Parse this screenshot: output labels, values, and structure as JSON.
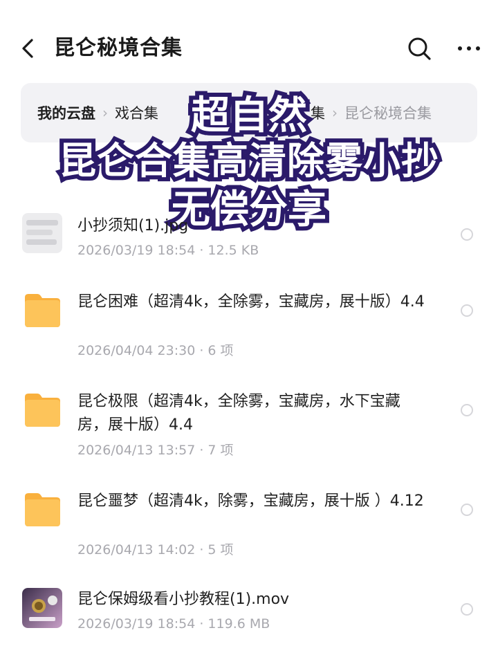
{
  "header": {
    "title": "昆仑秘境合集"
  },
  "breadcrumb": {
    "items": [
      "我的云盘",
      "游戏合集",
      "",
      "集",
      "昆仑秘境合集"
    ],
    "visible": [
      "我的云盘",
      "戏合集",
      "集",
      "昆仑秘境合集"
    ]
  },
  "banner": {
    "line1": "超自然",
    "line2": "昆仑合集高清除雾小抄",
    "line3": "无偿分享"
  },
  "files": [
    {
      "name": "小抄须知(1).jpg",
      "meta": "2026/03/19 18:54 · 12.5 KB",
      "type": "image"
    },
    {
      "name": "昆仑困难（超清4k，全除雾，宝藏房，展十版）4.4",
      "meta": "2026/04/04 23:30 · 6 项",
      "type": "folder"
    },
    {
      "name": "昆仑极限（超清4k，全除雾，宝藏房，水下宝藏房，展十版）4.4",
      "meta": "2026/04/13 13:57 · 7 项",
      "type": "folder"
    },
    {
      "name": "昆仑噩梦（超清4k，除雾，宝藏房，展十版 ）4.12",
      "meta": "2026/04/13 14:02 · 5 项",
      "type": "folder"
    },
    {
      "name": "昆仑保姆级看小抄教程(1).mov",
      "meta": "2026/03/19 18:54 · 119.6 MB",
      "type": "video"
    }
  ],
  "icons": {
    "back": "chevron-left-icon",
    "search": "search-icon",
    "more": "more-horizontal-icon",
    "folder": "folder-icon"
  },
  "colors": {
    "folder": "#FDBE4E",
    "banner_stroke": "#2B1B6A",
    "breadcrumb_bg": "#F2F2F5",
    "meta_text": "#A8A8AE"
  }
}
